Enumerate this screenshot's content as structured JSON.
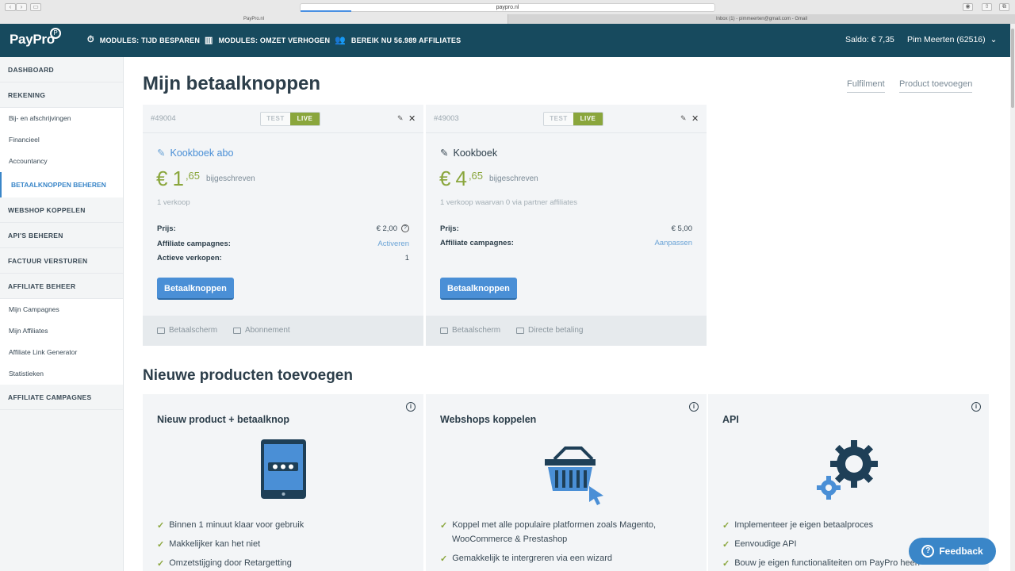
{
  "browser": {
    "url": "paypro.nl",
    "tabs": [
      "PayPro.nl",
      "Inbox (1) - pimmeerten@gmail.com - Gmail"
    ]
  },
  "topbar": {
    "logo": "PayPro",
    "nav": [
      {
        "label": "MODULES: TIJD BESPAREN",
        "icon": "stopwatch-icon"
      },
      {
        "label": "MODULES: OMZET VERHOGEN",
        "icon": "buildings-icon"
      },
      {
        "label": "BEREIK NU 56.989 AFFILIATES",
        "icon": "users-icon"
      }
    ],
    "saldo": "Saldo: € 7,35",
    "user": "Pim Meerten (62516)"
  },
  "sidebar": {
    "dashboard": "DASHBOARD",
    "rekening": "REKENING",
    "rekening_sub": [
      "Bij- en afschrijvingen",
      "Financieel",
      "Accountancy"
    ],
    "active": "BETAALKNOPPEN BEHEREN",
    "webshop": "WEBSHOP KOPPELEN",
    "apis": "API'S BEHEREN",
    "factuur": "FACTUUR VERSTUREN",
    "affiliate_beheer": "AFFILIATE BEHEER",
    "affiliate_sub": [
      "Mijn Campagnes",
      "Mijn Affiliates",
      "Affiliate Link Generator",
      "Statistieken"
    ],
    "affiliate_campagnes": "AFFILIATE CAMPAGNES"
  },
  "main": {
    "title": "Mijn betaalknoppen",
    "links": [
      "Fulfilment",
      "Product toevoegen"
    ],
    "cards": [
      {
        "id": "#49004",
        "test": "TEST",
        "live": "LIVE",
        "name": "Kookboek abo",
        "currency": "€",
        "euros": "1",
        "cents": ",65",
        "bijgeschreven": "bijgeschreven",
        "sales": "1 verkoop",
        "prijs_label": "Prijs:",
        "prijs": "€ 2,00",
        "aff_label": "Affiliate campagnes:",
        "aff_value": "Activeren",
        "actief_label": "Actieve verkopen:",
        "actief_value": "1",
        "button": "Betaalknoppen",
        "footer": [
          "Betaalscherm",
          "Abonnement"
        ]
      },
      {
        "id": "#49003",
        "test": "TEST",
        "live": "LIVE",
        "name": "Kookboek",
        "currency": "€",
        "euros": "4",
        "cents": ",65",
        "bijgeschreven": "bijgeschreven",
        "sales": "1 verkoop waarvan 0 via partner affiliates",
        "prijs_label": "Prijs:",
        "prijs": "€ 5,00",
        "aff_label": "Affiliate campagnes:",
        "aff_value": "Aanpassen",
        "button": "Betaalknoppen",
        "footer": [
          "Betaalscherm",
          "Directe betaling"
        ]
      }
    ],
    "section_title": "Nieuwe producten toevoegen",
    "products": [
      {
        "title": "Nieuw product + betaalknop",
        "features": [
          "Binnen 1 minuut klaar voor gebruik",
          "Makkelijker kan het niet",
          "Omzetstijging door Retargetting"
        ]
      },
      {
        "title": "Webshops koppelen",
        "features": [
          "Koppel met alle populaire platformen zoals Magento,",
          "WooCommerce & Prestashop",
          "Gemakkelijk te intergreren via een wizard"
        ]
      },
      {
        "title": "API",
        "features": [
          "Implementeer je eigen betaalproces",
          "Eenvoudige API",
          "Bouw je eigen functionaliteiten om PayPro heen"
        ]
      }
    ]
  },
  "feedback": "Feedback"
}
